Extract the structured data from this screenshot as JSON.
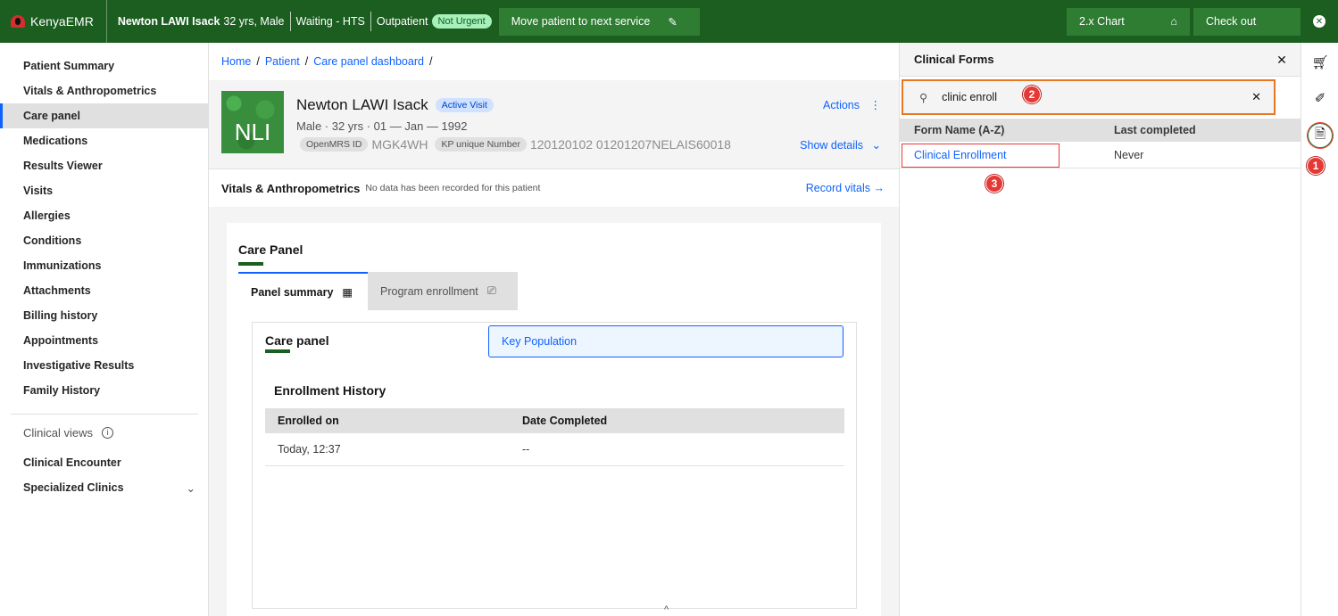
{
  "topbar": {
    "brand": "KenyaEMR",
    "patient_name": "Newton LAWI Isack",
    "patient_info": "32 yrs, Male",
    "visit_status": "Waiting - HTS",
    "visit_type": "Outpatient",
    "priority_badge": "Not Urgent",
    "move_button": "Move patient to next service",
    "chart_link": "2.x Chart",
    "checkout": "Check out"
  },
  "leftnav": {
    "items": [
      {
        "label": "Patient Summary"
      },
      {
        "label": "Vitals & Anthropometrics"
      },
      {
        "label": "Care panel"
      },
      {
        "label": "Medications"
      },
      {
        "label": "Results Viewer"
      },
      {
        "label": "Visits"
      },
      {
        "label": "Allergies"
      },
      {
        "label": "Conditions"
      },
      {
        "label": "Immunizations"
      },
      {
        "label": "Attachments"
      },
      {
        "label": "Billing history"
      },
      {
        "label": "Appointments"
      },
      {
        "label": "Investigative Results"
      },
      {
        "label": "Family History"
      }
    ],
    "active_index": 2,
    "section_label": "Clinical views",
    "section_items": [
      {
        "label": "Clinical Encounter"
      },
      {
        "label": "Specialized Clinics"
      }
    ]
  },
  "breadcrumb": {
    "items": [
      "Home",
      "Patient",
      "Care panel dashboard"
    ]
  },
  "patient_banner": {
    "initials": "NLI",
    "name": "Newton LAWI Isack",
    "visit_badge": "Active Visit",
    "meta": "Male · 32 yrs · 01 — Jan — 1992",
    "openmrs_label": "OpenMRS ID",
    "openmrs_value": "MGK4WH",
    "kp_label": "KP unique Number",
    "kp_value": "120120102 01201207NELAIS60018",
    "actions": "Actions",
    "show_details": "Show details"
  },
  "vitals": {
    "title": "Vitals & Anthropometrics",
    "note": "No data has been recorded for this patient",
    "link": "Record vitals"
  },
  "care_panel": {
    "title": "Care Panel",
    "tabs": [
      {
        "label": "Panel summary"
      },
      {
        "label": "Program enrollment"
      }
    ],
    "inner_title": "Care panel",
    "program_button": "Key Population",
    "enrollment_title": "Enrollment History",
    "table_headers": [
      "Enrolled on",
      "Date Completed"
    ],
    "table_rows": [
      [
        "Today, 12:37",
        "--"
      ]
    ]
  },
  "forms_panel": {
    "title": "Clinical Forms",
    "search_value": "clinic enroll",
    "headers": [
      "Form Name (A-Z)",
      "Last completed"
    ],
    "rows": [
      {
        "name": "Clinical Enrollment",
        "last": "Never"
      }
    ]
  },
  "markers": [
    "1",
    "2",
    "3"
  ],
  "colors": {
    "topbar": "#1b5e20",
    "accent_blue": "#0f62fe",
    "highlight_red": "#e53935",
    "search_border": "#e87722"
  }
}
